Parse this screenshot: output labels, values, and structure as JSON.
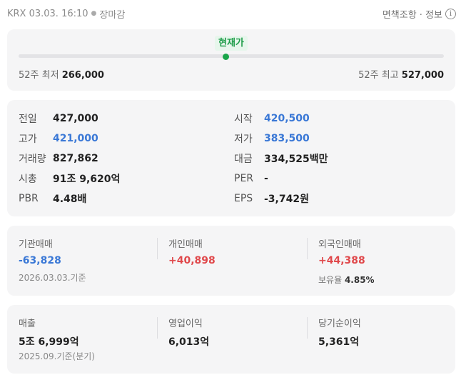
{
  "header": {
    "market": "KRX 03.03. 16:10",
    "status": "장마감",
    "disclaimer": "면책조항 · 정보",
    "info_glyph": "i"
  },
  "range52": {
    "current_label": "현재가",
    "low_label": "52주 최저",
    "low_value": "266,000",
    "high_label": "52주 최고",
    "high_value": "527,000",
    "current_position": 0.49
  },
  "quote": {
    "prev_close_label": "전일",
    "prev_close": "427,000",
    "open_label": "시작",
    "open": "420,500",
    "high_label": "고가",
    "high": "421,000",
    "low_label": "저가",
    "low": "383,500",
    "volume_label": "거래량",
    "volume": "827,862",
    "amount_label": "대금",
    "amount": "334,525백만",
    "mcap_label": "시총",
    "mcap": "91조 9,620억",
    "per_label": "PER",
    "per": "-",
    "pbr_label": "PBR",
    "pbr": "4.48배",
    "eps_label": "EPS",
    "eps": "-3,742원"
  },
  "investors": {
    "institution_label": "기관매매",
    "institution": "-63,828",
    "individual_label": "개인매매",
    "individual": "+40,898",
    "foreign_label": "외국인매매",
    "foreign": "+44,388",
    "holding_label": "보유율",
    "holding": "4.85%",
    "date": "2026.03.03.기준"
  },
  "financials": {
    "revenue_label": "매출",
    "revenue": "5조 6,999억",
    "op_income_label": "영업이익",
    "op_income": "6,013억",
    "net_income_label": "당기순이익",
    "net_income": "5,361억",
    "date": "2025.09.기준(분기)"
  },
  "colors": {
    "accent_green": "#1aa54a",
    "up_red": "#e0484b",
    "down_blue": "#3a78d6",
    "card_bg": "#f5f5f6"
  }
}
